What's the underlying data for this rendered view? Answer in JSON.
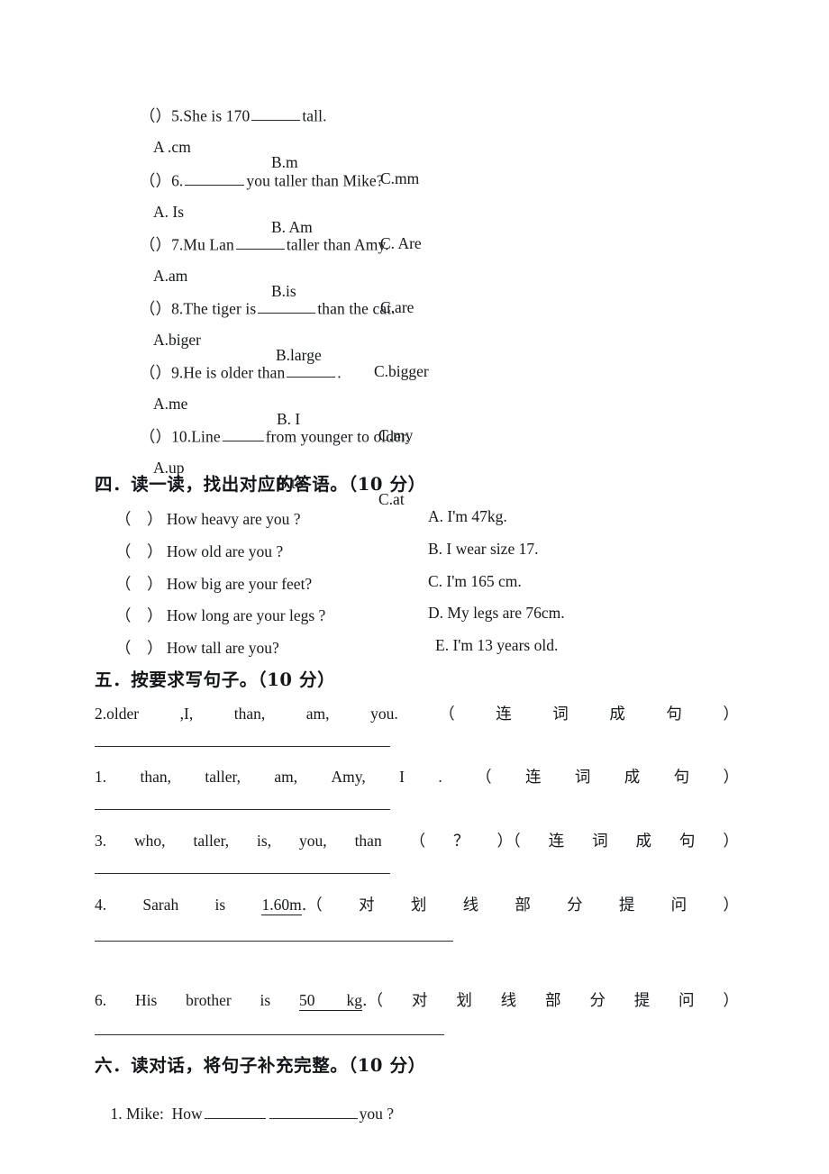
{
  "document": {
    "type": "english-exam-worksheet",
    "language": "en-zh"
  },
  "multiple_choice": {
    "questions": [
      {
        "bracket_open": "（",
        "bracket_close": "）",
        "number": "5.",
        "stem_before": "She is 170",
        "stem_after": "tall.",
        "options": [
          "A .cm",
          "B.m",
          "C.mm"
        ]
      },
      {
        "bracket_open": "（",
        "bracket_close": "）",
        "number": "6.",
        "stem_before": "",
        "stem_after": "you taller than Mike?",
        "options": [
          "A. Is",
          "B. Am",
          "C. Are"
        ]
      },
      {
        "bracket_open": "（",
        "bracket_close": "）",
        "number": "7.",
        "stem_before": "Mu Lan",
        "stem_after": "taller than Amy.",
        "options": [
          "A.am",
          "B.is",
          "C.are"
        ]
      },
      {
        "bracket_open": "（",
        "bracket_close": "）",
        "number": "8.",
        "stem_before": "The tiger is",
        "stem_after": "than the cat.",
        "options": [
          "A.biger",
          "B.large",
          "C.bigger"
        ]
      },
      {
        "bracket_open": "（",
        "bracket_close": "）",
        "number": "9.",
        "stem_before": "He is older than",
        "stem_after": ".",
        "options": [
          "A.me",
          "B. I",
          "C.my"
        ]
      },
      {
        "bracket_open": "（",
        "bracket_close": "）",
        "number": "10.",
        "stem_before": "Line",
        "stem_after": "from younger to older.",
        "options": [
          "A.up",
          "B.to",
          "C.at"
        ]
      }
    ]
  },
  "section_four": {
    "heading": "四．读一读，找出对应的答语。（10 分）",
    "questions": [
      "（　） How heavy are you ?",
      "（　） How old are you ?",
      "（　） How big are your feet?",
      "（　） How long are your legs ?",
      "（　） How tall are you?"
    ],
    "answers": [
      "A. I'm 47kg.",
      "B. I wear size 17.",
      "C. I'm 165 cm.",
      "D. My legs are 76cm.",
      "E. I'm 13 years old."
    ]
  },
  "section_five": {
    "heading": "五．按要求写句子。（10 分）",
    "items": [
      {
        "number": "2.older",
        "words": [
          ",I,",
          "than,",
          "am,",
          "you."
        ],
        "instruction_parts": [
          "（",
          "连",
          "词",
          "成",
          "句",
          "）"
        ],
        "answer_rule_width": 328
      },
      {
        "number": "1.",
        "words": [
          "than,",
          "taller,",
          "am,",
          "Amy,",
          "I",
          "."
        ],
        "instruction_parts": [
          "（",
          "连",
          "词",
          "成",
          "句",
          "）"
        ],
        "answer_rule_width": 328
      },
      {
        "number": "3.",
        "words": [
          "who,",
          "taller,",
          "is,",
          "you,",
          "than"
        ],
        "instruction_parts": [
          "（",
          "？",
          "）（",
          "连",
          "词",
          "成",
          "句",
          "）"
        ],
        "answer_rule_width": 328
      },
      {
        "number": "4.",
        "words": [
          "Sarah",
          "is"
        ],
        "underlined": "1.60m",
        "tail": ".（",
        "instruction_parts": [
          "对",
          "划",
          "线",
          "部",
          "分",
          "提",
          "问",
          "）"
        ],
        "answer_rule_width": 398
      },
      {
        "number": "6.",
        "words": [
          "His",
          "brother",
          "is"
        ],
        "underlined": "50　　kg",
        "tail": ".（",
        "instruction_parts": [
          "对",
          "划",
          "线",
          "部",
          "分",
          "提",
          "问",
          "）"
        ],
        "answer_rule_width": 388
      }
    ]
  },
  "section_six": {
    "heading": "六．读对话，将句子补充完整。（10 分）",
    "line_one": {
      "number": "1.",
      "speaker": "Mike:",
      "text_before": "How",
      "text_after": "you ?"
    }
  }
}
